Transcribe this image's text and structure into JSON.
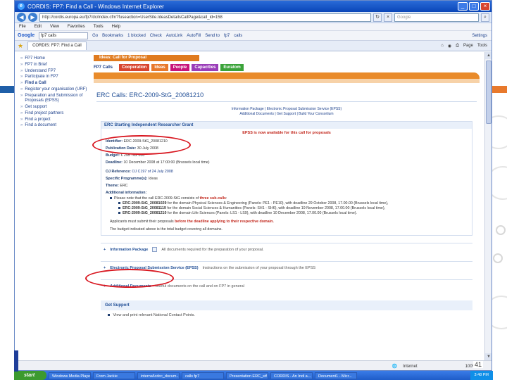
{
  "window": {
    "title": "CORDIS: FP7: Find a Call - Windows Internet Explorer",
    "url": "http://cordis.europa.eu/fp7/dc/index.cfm?fuseaction=UserSite.IdeasDetailsCallPage&call_id=158",
    "search_placeholder": "Google",
    "tab_title": "CORDIS: FP7: Find a Call"
  },
  "menubar": [
    "File",
    "Edit",
    "View",
    "Favorites",
    "Tools",
    "Help"
  ],
  "googlebar": {
    "logo": "Google",
    "input_value": "fp7 calls",
    "items": [
      "Go",
      "Bookmarks",
      "1 blocked",
      "Check",
      "AutoLink",
      "AutoFill",
      "Send to",
      "fp7",
      "calls",
      "Settings"
    ]
  },
  "commandbar": [
    "Page",
    "Tools"
  ],
  "leftnav": [
    "FP7 Home",
    "FP7 in Brief",
    "Understand FP7",
    "Participate in FP7",
    "Find a Call",
    "Register your organisation (URF)",
    "Preparation and Submission of Proposals (EPSS)",
    "Get support",
    "Find project partners",
    "Find a project",
    "Find a document"
  ],
  "main": {
    "breadcrumb": "Ideas: Call for Proposal",
    "calls_label": "FP7 Calls",
    "programme_tabs": [
      {
        "label": "Cooperation",
        "color": "#d8452f"
      },
      {
        "label": "Ideas",
        "color": "#e8792c"
      },
      {
        "label": "People",
        "color": "#c7147a"
      },
      {
        "label": "Capacities",
        "color": "#9a3db8"
      },
      {
        "label": "Euratom",
        "color": "#3aa339"
      }
    ],
    "erc_title": "ERC Calls: ERC-2009-StG_20081210",
    "links_line1": "Information Package | Electronic Proposal Submission Service (EPSS)",
    "links_line2": "Additional Documents | Get Support | Build Your Consortium",
    "box_title": "ERC Starting Independent Researcher Grant",
    "epss_notice": "EPSS is now available for this call for proposals",
    "identifier_label": "Identifier:",
    "identifier_value": "ERC-2009-StG_20081210",
    "publication_label": "Publication Date:",
    "publication_value": "30 July 2008",
    "budget_label": "Budget:",
    "budget_value": "€ 295 762 000",
    "deadline_label": "Deadline:",
    "deadline_value": "10 December 2008 at 17:00:00 (Brussels local time)",
    "oj_label": "OJ Reference:",
    "oj_value": "OJ C197 of 24 July 2008",
    "specific_label": "Specific Programme(s):",
    "specific_value": "Ideas",
    "theme_label": "Theme:",
    "theme_value": "ERC",
    "additional_label": "Additional information:",
    "note_text": "Please note that the call ERC-2009-StG consists of",
    "note_red": "three sub-calls",
    "subcalls": [
      {
        "id": "ERC-2009-StG_20081029",
        "text": "for the domain Physical Sciences & Engineering (Panels: PE1 - PE10), with deadline 29 October 2008, 17.00.00 (Brussels local time),"
      },
      {
        "id": "ERC-2009-StG_20081119",
        "text": "for the domain Social Sciences & Humanities (Panels: SH1 - SH6), with deadline 19 November 2008, 17.00.00 (Brussels local time),"
      },
      {
        "id": "ERC-2009-StG_20081210",
        "text": "for the domain Life Sciences (Panels: LS1 - LS9), with deadline 10 December 2008, 17.00.00 (Brussels local time)."
      }
    ],
    "applicants_text": "Applicants must submit their proposals",
    "applicants_red": "before the deadline applying to their respective domain.",
    "budget_note": "The budget indicated above is the total budget covering all domains.",
    "sections": [
      {
        "title": "Information Package",
        "desc": "All documents required for the preparation of your proposal."
      },
      {
        "title": "Electronic Proposal Submission Service (EPSS)",
        "desc": "Instructions on the submission of your proposal through the EPSS"
      },
      {
        "title": "Additional Documents",
        "desc": "Useful documents on the call and on FP7 in general"
      }
    ],
    "get_support_title": "Get Support",
    "get_support_item": "View and print relevant National Contact Points."
  },
  "statusbar": {
    "zone": "Internet",
    "zoom": "100%"
  },
  "taskbar": {
    "start": "start",
    "tasks": [
      "Windows Media Player",
      "From Jackie",
      "internal\\cdcc_docum...",
      "calls fp7",
      "Presentation ERC_stf",
      "CORDIS - An Indi a...",
      "Document1 - Micr..."
    ],
    "clock": "3:48 PM"
  },
  "slide_page_number": "41",
  "colors": {
    "accent_orange": "#e8792c",
    "link_blue": "#1a3e8a",
    "highlight_red": "#d8161f"
  }
}
